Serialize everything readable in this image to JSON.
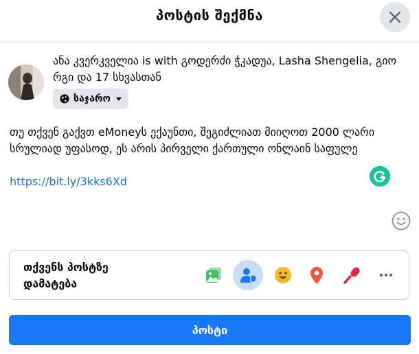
{
  "dialog": {
    "title": "პოსტის შექმნა",
    "close_icon": "close-icon"
  },
  "author": {
    "line": "ანა კვერკველია is with გოდერძი ჭკადუა, Lasha Shengelia, გიო რგი და 17 სხვასთან",
    "privacy_label": "საჯარო",
    "privacy_icon": "globe-icon"
  },
  "post": {
    "text": "თუ თქვენ გაქვთ eMoneyს ექაუნთი, შეგიძლიათ მიიღოთ 2000 ლარი სრულიად უფასოდ, ეს არის პირველი ქართული ონლაინ საფულე",
    "link": "https://bit.ly/3kks6Xd"
  },
  "add_to_post": {
    "label": "თქვენს პოსტზე დამატება",
    "tools": [
      {
        "icon": "photo-video-icon"
      },
      {
        "icon": "tag-people-icon"
      },
      {
        "icon": "feeling-icon"
      },
      {
        "icon": "check-in-icon"
      },
      {
        "icon": "live-video-icon"
      },
      {
        "icon": "more-icon"
      }
    ]
  },
  "submit": {
    "label": "პოსტი"
  },
  "colors": {
    "accent": "#1877f2",
    "link": "#216fdb",
    "grammarly": "#15c39a",
    "photo": "#45bd62",
    "feeling": "#f7b928",
    "location": "#f5533d",
    "live": "#e42645"
  }
}
